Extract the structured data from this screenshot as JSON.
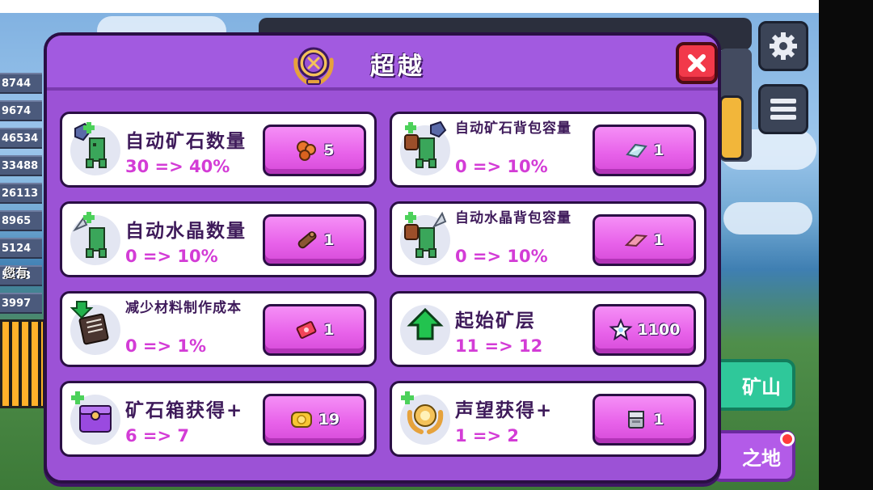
{
  "dialog": {
    "title": "超越",
    "close_icon": "close-x-icon",
    "upgrades": [
      {
        "name": "自动矿石数量",
        "value": "30 => 40%",
        "cost": "5",
        "cost_icon": "copper-ore-icon",
        "icon": "auto-miner-ore-icon"
      },
      {
        "name": "自动矿石背包容量",
        "value": "0 => 10%",
        "cost": "1",
        "cost_icon": "silver-bar-icon",
        "icon": "ore-backpack-icon"
      },
      {
        "name": "自动水晶数量",
        "value": "0 => 10%",
        "cost": "1",
        "cost_icon": "wood-log-icon",
        "icon": "auto-miner-crystal-icon"
      },
      {
        "name": "自动水晶背包容量",
        "value": "0 => 10%",
        "cost": "1",
        "cost_icon": "pink-plank-icon",
        "icon": "crystal-backpack-icon"
      },
      {
        "name": "减少材料制作成本",
        "value": "0 => 1%",
        "cost": "1",
        "cost_icon": "red-ticket-icon",
        "icon": "book-down-arrow-icon"
      },
      {
        "name": "起始矿层",
        "value": "11 => 12",
        "cost": "1100",
        "cost_icon": "star-gem-icon",
        "icon": "green-up-arrow-icon"
      },
      {
        "name": "矿石箱获得+",
        "value": "6 => 7",
        "cost": "19",
        "cost_icon": "gold-coin-icon",
        "icon": "ore-chest-icon"
      },
      {
        "name": "声望获得+",
        "value": "1 => 2",
        "cost": "1",
        "cost_icon": "stone-block-icon",
        "icon": "prestige-laurel-icon"
      }
    ]
  },
  "background": {
    "leaderboard_values": [
      "8744",
      "9674",
      "46534",
      "33488",
      "26113",
      "8965",
      "5124",
      "5283",
      "3997"
    ],
    "left_note": "您有",
    "green_button_label": "矿山",
    "purple_button_label": "之地",
    "settings_icon": "gear-icon",
    "menu_icon": "hamburger-menu-icon"
  },
  "colors": {
    "dialog_purple": "#9c52d6",
    "cost_button_pink": "#e863ea",
    "value_pink": "#d33cd6",
    "close_red": "#f2394a"
  }
}
